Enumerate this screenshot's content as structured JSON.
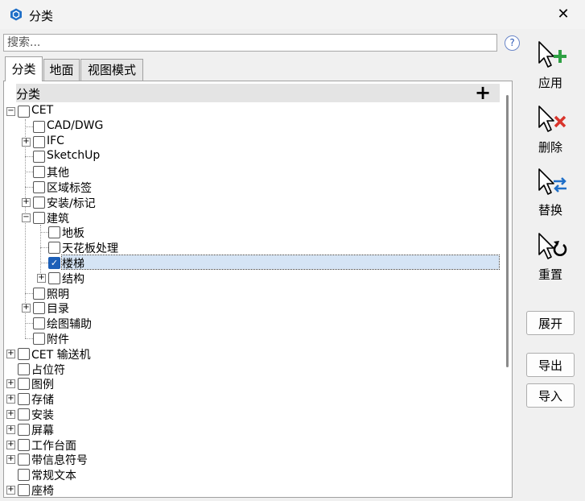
{
  "window": {
    "title": "分类",
    "close_icon": "✕"
  },
  "search": {
    "placeholder": "搜索...",
    "help": "?"
  },
  "tabs": [
    {
      "label": "分类",
      "active": true
    },
    {
      "label": "地面",
      "active": false
    },
    {
      "label": "视图模式",
      "active": false
    }
  ],
  "tree": {
    "header": "分类",
    "add": "+",
    "items": [
      {
        "label": "CET",
        "level": 0,
        "expander": "minus",
        "checked": false
      },
      {
        "label": "CAD/DWG",
        "level": 1,
        "expander": "",
        "checked": false
      },
      {
        "label": "IFC",
        "level": 1,
        "expander": "plus",
        "checked": false
      },
      {
        "label": "SketchUp",
        "level": 1,
        "expander": "",
        "checked": false
      },
      {
        "label": "其他",
        "level": 1,
        "expander": "",
        "checked": false
      },
      {
        "label": "区域标签",
        "level": 1,
        "expander": "",
        "checked": false
      },
      {
        "label": "安装/标记",
        "level": 1,
        "expander": "plus",
        "checked": false
      },
      {
        "label": "建筑",
        "level": 1,
        "expander": "minus",
        "checked": false
      },
      {
        "label": "地板",
        "level": 2,
        "expander": "",
        "checked": false
      },
      {
        "label": "天花板处理",
        "level": 2,
        "expander": "",
        "checked": false
      },
      {
        "label": "楼梯",
        "level": 2,
        "expander": "",
        "checked": true,
        "selected": true
      },
      {
        "label": "结构",
        "level": 2,
        "expander": "plus",
        "checked": false
      },
      {
        "label": "照明",
        "level": 1,
        "expander": "",
        "checked": false
      },
      {
        "label": "目录",
        "level": 1,
        "expander": "plus",
        "checked": false
      },
      {
        "label": "绘图辅助",
        "level": 1,
        "expander": "",
        "checked": false
      },
      {
        "label": "附件",
        "level": 1,
        "expander": "",
        "checked": false
      },
      {
        "label": "CET 输送机",
        "level": 0,
        "expander": "plus",
        "checked": false
      },
      {
        "label": "占位符",
        "level": 0,
        "expander": "",
        "checked": false
      },
      {
        "label": "图例",
        "level": 0,
        "expander": "plus",
        "checked": false
      },
      {
        "label": "存储",
        "level": 0,
        "expander": "plus",
        "checked": false
      },
      {
        "label": "安装",
        "level": 0,
        "expander": "plus",
        "checked": false
      },
      {
        "label": "屏幕",
        "level": 0,
        "expander": "plus",
        "checked": false
      },
      {
        "label": "工作台面",
        "level": 0,
        "expander": "plus",
        "checked": false
      },
      {
        "label": "带信息符号",
        "level": 0,
        "expander": "plus",
        "checked": false
      },
      {
        "label": "常规文本",
        "level": 0,
        "expander": "",
        "checked": false
      },
      {
        "label": "座椅",
        "level": 0,
        "expander": "plus",
        "checked": false
      }
    ]
  },
  "tools": [
    {
      "label": "应用",
      "icon": "cursor-add-icon",
      "accent": "#2ea043"
    },
    {
      "label": "删除",
      "icon": "cursor-delete-icon",
      "accent": "#d9342b"
    },
    {
      "label": "替换",
      "icon": "cursor-replace-icon",
      "accent": "#1f6fc8"
    },
    {
      "label": "重置",
      "icon": "cursor-reset-icon",
      "accent": "#000000"
    }
  ],
  "buttons": {
    "expand": "展开",
    "export": "导出",
    "import": "导入"
  }
}
